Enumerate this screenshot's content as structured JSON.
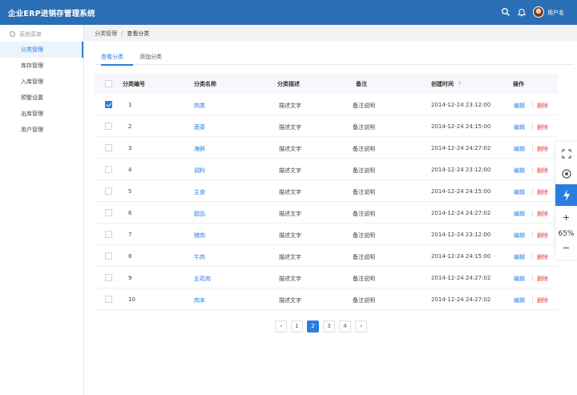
{
  "app": {
    "title": "企业ERP进销存管理系统",
    "username": "用户名"
  },
  "colors": {
    "topbar": "#2a6fb5",
    "accent": "#2a7de1",
    "danger": "#e0413a"
  },
  "sidebar": {
    "header": "系统菜单",
    "items": [
      {
        "label": "分类管理",
        "active": true
      },
      {
        "label": "库存管理"
      },
      {
        "label": "入库管理"
      },
      {
        "label": "预警设置"
      },
      {
        "label": "出库管理"
      },
      {
        "label": "用户管理"
      }
    ]
  },
  "breadcrumb": {
    "parent": "分类管理",
    "separator": "/",
    "current": "查看分类"
  },
  "tabs": [
    {
      "label": "查看分类",
      "active": true
    },
    {
      "label": "添加分类"
    }
  ],
  "table": {
    "headers": {
      "id": "分类编号",
      "name": "分类名称",
      "desc": "分类描述",
      "note": "备注",
      "created": "创建时间",
      "sort": "↑",
      "actions": "操作"
    },
    "edit_label": "编辑",
    "delete_label": "删除",
    "rows": [
      {
        "id": "1",
        "name": "肉类",
        "desc": "描述文字",
        "note": "备注说明",
        "created": "2014-12-24 23:12:00",
        "checked": true
      },
      {
        "id": "2",
        "name": "蔬菜",
        "desc": "描述文字",
        "note": "备注说明",
        "created": "2014-12-24 24:15:00"
      },
      {
        "id": "3",
        "name": "海鲜",
        "desc": "描述文字",
        "note": "备注说明",
        "created": "2014-12-24 24:27:02"
      },
      {
        "id": "4",
        "name": "调料",
        "desc": "描述文字",
        "note": "备注说明",
        "created": "2014-12-24 23:12:00"
      },
      {
        "id": "5",
        "name": "主食",
        "desc": "描述文字",
        "note": "备注说明",
        "created": "2014-12-24 24:15:00"
      },
      {
        "id": "6",
        "name": "甜品",
        "desc": "描述文字",
        "note": "备注说明",
        "created": "2014-12-24 24:27:02"
      },
      {
        "id": "7",
        "name": "猪肉",
        "desc": "描述文字",
        "note": "备注说明",
        "created": "2014-12-24 23:12:00"
      },
      {
        "id": "8",
        "name": "牛肉",
        "desc": "描述文字",
        "note": "备注说明",
        "created": "2014-12-24 24:15:00"
      },
      {
        "id": "9",
        "name": "五花肉",
        "desc": "描述文字",
        "note": "备注说明",
        "created": "2014-12-24 24:27:02"
      },
      {
        "id": "10",
        "name": "肉末",
        "desc": "描述文字",
        "note": "备注说明",
        "created": "2014-12-24 24:27:02"
      }
    ]
  },
  "pagination": {
    "prev": "‹",
    "next": "›",
    "pages": [
      "1",
      "2",
      "3",
      "4"
    ],
    "current": "2"
  },
  "float_tools": {
    "zoom_in": "+",
    "zoom_level": "65%",
    "zoom_out": "−"
  }
}
